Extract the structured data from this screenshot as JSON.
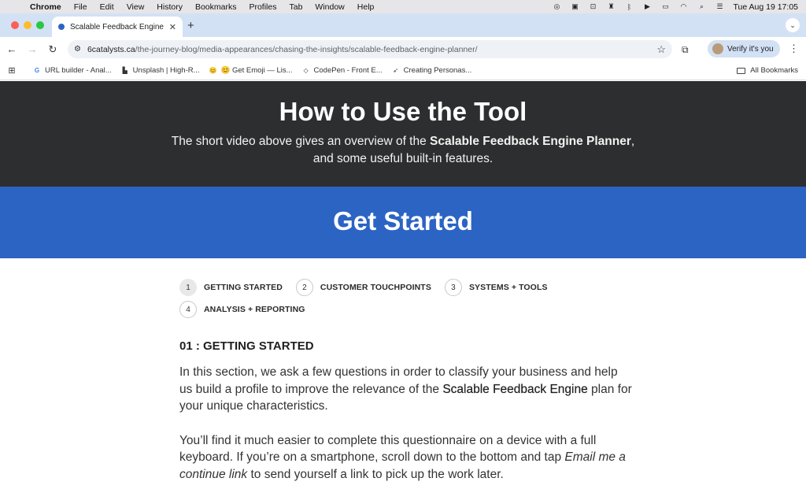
{
  "menubar": {
    "app": "Chrome",
    "items": [
      "File",
      "Edit",
      "View",
      "History",
      "Bookmarks",
      "Profiles",
      "Tab",
      "Window",
      "Help"
    ],
    "clock": "Tue Aug 19  17:05"
  },
  "tab": {
    "title": "Scalable Feedback Engine Pla",
    "close": "✕",
    "new_tab": "+"
  },
  "toolbar": {
    "url_domain": "6catalysts.ca",
    "url_path": "/the-journey-blog/media-appearances/chasing-the-insights/scalable-feedback-engine-planner/",
    "verify_label": "Verify it's you"
  },
  "bookmarks": {
    "items": [
      {
        "label": "URL builder - Anal...",
        "icon": "G",
        "color": "#4285f4"
      },
      {
        "label": "Unsplash | High-R...",
        "icon": "▙",
        "color": "#111111"
      },
      {
        "label": "😊 Get Emoji — Lis...",
        "icon": "😊",
        "color": "#f4b400"
      },
      {
        "label": "CodePen - Front E...",
        "icon": "◇",
        "color": "#333333"
      },
      {
        "label": "Creating Personas...",
        "icon": "➶",
        "color": "#8bc34a"
      }
    ],
    "all_label": "All Bookmarks"
  },
  "hero": {
    "title": "How to Use the Tool",
    "line1_before": "The short video above gives an overview of the ",
    "line1_strong": "Scalable Feedback Engine Planner",
    "line1_after": ",",
    "line2": "and some useful built-in features."
  },
  "banner": {
    "title": "Get Started"
  },
  "steps": [
    {
      "number": "1",
      "label": "GETTING STARTED",
      "active": true
    },
    {
      "number": "2",
      "label": "CUSTOMER TOUCHPOINTS",
      "active": false
    },
    {
      "number": "3",
      "label": "SYSTEMS + TOOLS",
      "active": false
    },
    {
      "number": "4",
      "label": "ANALYSIS + REPORTING",
      "active": false
    }
  ],
  "section": {
    "heading": "01 : GETTING STARTED",
    "p1_before": "In this section, we ask a few questions in order to classify your business and help us build a profile to improve the relevance of the ",
    "p1_strong": "Scalable Feedback Engine",
    "p1_after": " plan for your unique characteristics.",
    "p2_before": "You’ll find it much easier to complete this questionnaire on a device with a full keyboard. If you’re on a smartphone, scroll down to the bottom and tap ",
    "p2_em": "Email me a continue link",
    "p2_after": " to send yourself a link to pick up the work later."
  }
}
